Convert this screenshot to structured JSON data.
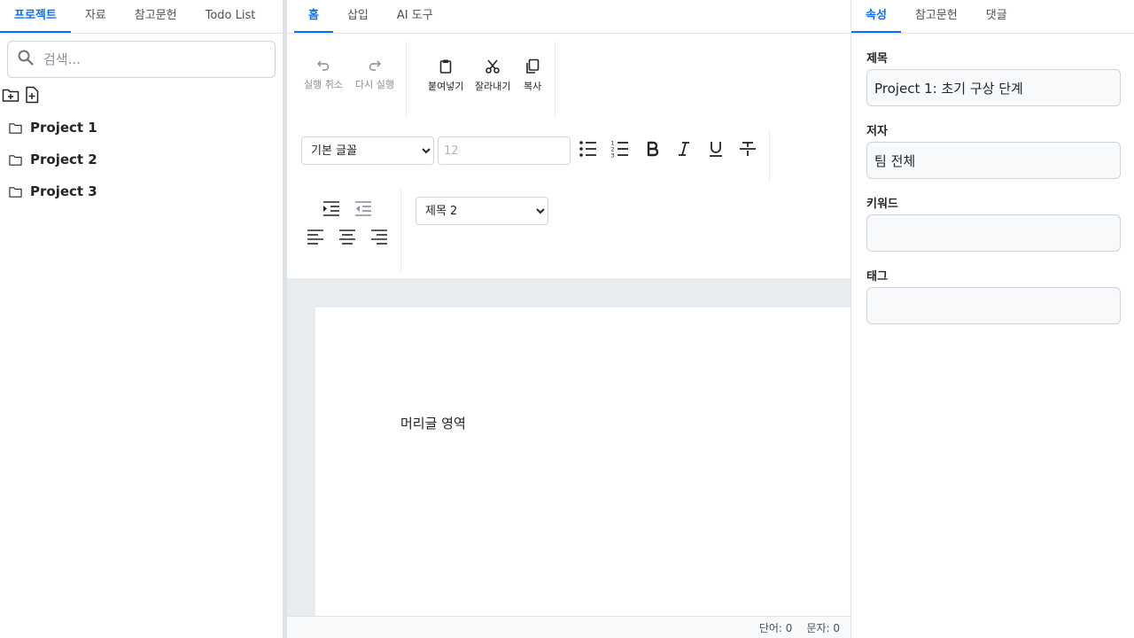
{
  "left": {
    "tabs": [
      "프로젝트",
      "자료",
      "참고문헌",
      "Todo List"
    ],
    "search_placeholder": "검색...",
    "projects": [
      "Project 1",
      "Project 2",
      "Project 3"
    ]
  },
  "ribbon": {
    "tabs": [
      "홈",
      "삽입",
      "AI 도구"
    ],
    "undo": "실행 취소",
    "redo": "다시 실행",
    "paste": "붙여넣기",
    "cut": "잘라내기",
    "copy": "복사",
    "font_family": "기본 글꼴",
    "font_size_placeholder": "12",
    "heading_style": "제목 2"
  },
  "document": {
    "header_text": "머리글 영역"
  },
  "status": {
    "words": "단어: 0",
    "chars": "문자: 0"
  },
  "right": {
    "tabs": [
      "속성",
      "참고문헌",
      "댓글"
    ],
    "title_label": "제목",
    "title_value": "Project 1: 초기 구상 단계",
    "author_label": "저자",
    "author_value": "팀 전체",
    "keywords_label": "키워드",
    "keywords_value": "",
    "tags_label": "태그",
    "tags_value": ""
  }
}
